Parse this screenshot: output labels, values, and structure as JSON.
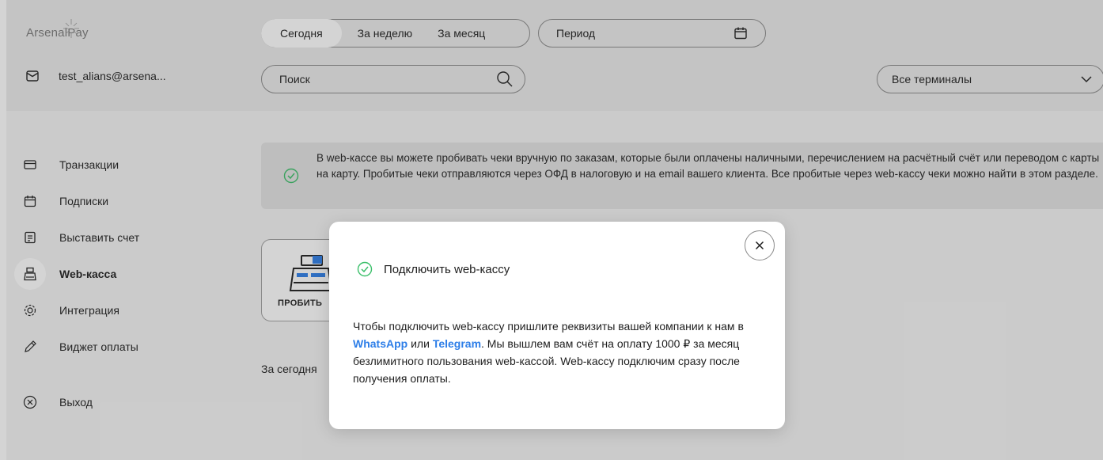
{
  "brand": {
    "logo_text": "ArsenalPay"
  },
  "user": {
    "email": "test_alians@arsena..."
  },
  "period_tabs": [
    {
      "label": "Сегодня",
      "active": true
    },
    {
      "label": "За неделю",
      "active": false
    },
    {
      "label": "За месяц",
      "active": false
    }
  ],
  "period_picker": {
    "label": "Период",
    "icon": "calendar-icon"
  },
  "search": {
    "placeholder": "Поиск",
    "icon": "search-icon"
  },
  "terminal_select": {
    "value": "Все терминалы",
    "icon": "chevron-down-icon"
  },
  "nav": [
    {
      "label": "Транзакции",
      "icon": "card-icon",
      "active": false
    },
    {
      "label": "Подписки",
      "icon": "calendar-icon",
      "active": false
    },
    {
      "label": "Выставить счет",
      "icon": "invoice-icon",
      "active": false
    },
    {
      "label": "Web-касса",
      "icon": "cash-register-icon",
      "active": true
    },
    {
      "label": "Интеграция",
      "icon": "gear-icon",
      "active": false
    },
    {
      "label": "Виджет оплаты",
      "icon": "pencil-icon",
      "active": false
    },
    {
      "label": "Выход",
      "icon": "close-circle-icon",
      "active": false
    }
  ],
  "info_banner": {
    "text": "В web-кассе вы можете пробивать чеки вручную по заказам, которые были оплачены наличными, перечислением на расчётный счёт или переводом с карты на карту. Пробитые чеки отправляются через ОФД в налоговую и на email вашего клиента. Все пробитые через web-кассу чеки можно найти в этом разделе."
  },
  "action_card": {
    "label": "ПРОБИТЬ"
  },
  "today_label": "За сегодня",
  "modal": {
    "title": "Подключить web-кассу",
    "body_before": "Чтобы подключить web-кассу пришлите реквизиты вашей компании к нам в ",
    "link_whatsapp": "WhatsApp",
    "body_or": " или ",
    "link_telegram": "Telegram",
    "body_after": ". Мы вышлем вам счёт на оплату 1000 ₽ за месяц безлимитного пользования web-кассой. Web-кассу подключим сразу после получения оплаты."
  },
  "colors": {
    "accent": "#2d7ee8",
    "success": "#3bbf6a",
    "background": "#f4f4f4",
    "topbar": "#ebebeb"
  }
}
